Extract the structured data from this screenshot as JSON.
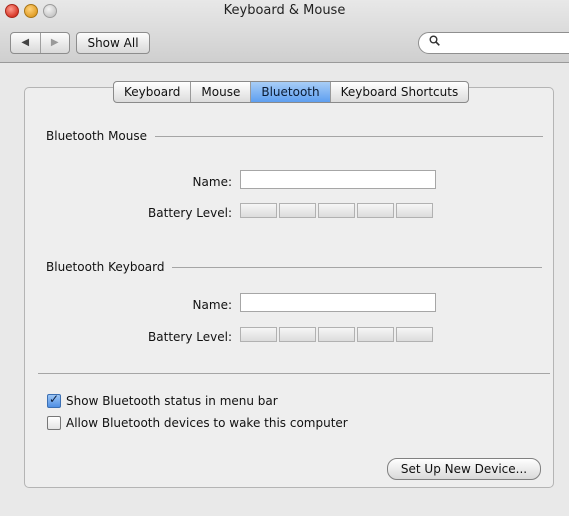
{
  "window": {
    "title": "Keyboard & Mouse"
  },
  "toolbar": {
    "back_glyph": "◀",
    "forward_glyph": "▶",
    "show_all_label": "Show All",
    "search_icon_glyph": "🔍",
    "search_value": ""
  },
  "tabs": [
    {
      "label": "Keyboard",
      "active": false
    },
    {
      "label": "Mouse",
      "active": false
    },
    {
      "label": "Bluetooth",
      "active": true
    },
    {
      "label": "Keyboard Shortcuts",
      "active": false
    }
  ],
  "bluetooth_mouse": {
    "heading": "Bluetooth Mouse",
    "name_label": "Name:",
    "name_value": "",
    "battery_label": "Battery Level:",
    "battery_level": 0
  },
  "bluetooth_keyboard": {
    "heading": "Bluetooth Keyboard",
    "name_label": "Name:",
    "name_value": "",
    "battery_label": "Battery Level:",
    "battery_level": 0
  },
  "options": {
    "show_status": {
      "label": "Show Bluetooth status in menu bar",
      "checked": true
    },
    "allow_wake": {
      "label": "Allow Bluetooth devices to wake this computer",
      "checked": false
    }
  },
  "setup_button_label": "Set Up New Device...",
  "colors": {
    "accent": "#5e9ff0",
    "window_bg": "#e9e9e9"
  }
}
